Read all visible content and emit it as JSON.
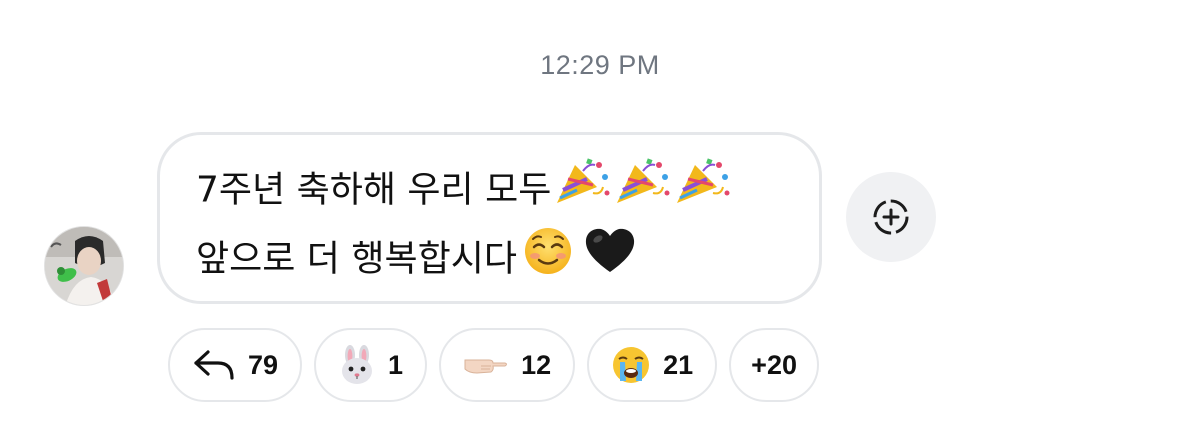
{
  "timestamp": "12:29 PM",
  "message": {
    "line1": "7주년 축하해 우리 모두",
    "line2": "앞으로 더 행복합시다",
    "line1_emojis": [
      "party-popper",
      "party-popper",
      "party-popper"
    ],
    "line2_emojis": [
      "smiling-face",
      "black-heart"
    ]
  },
  "reactions": [
    {
      "icon": "reply-arrow-icon",
      "count": "79"
    },
    {
      "icon": "rabbit-face-emoji",
      "count": "1"
    },
    {
      "icon": "pointing-hand-emoji",
      "count": "12"
    },
    {
      "icon": "crying-face-emoji",
      "count": "21"
    },
    {
      "label": "+20"
    }
  ]
}
